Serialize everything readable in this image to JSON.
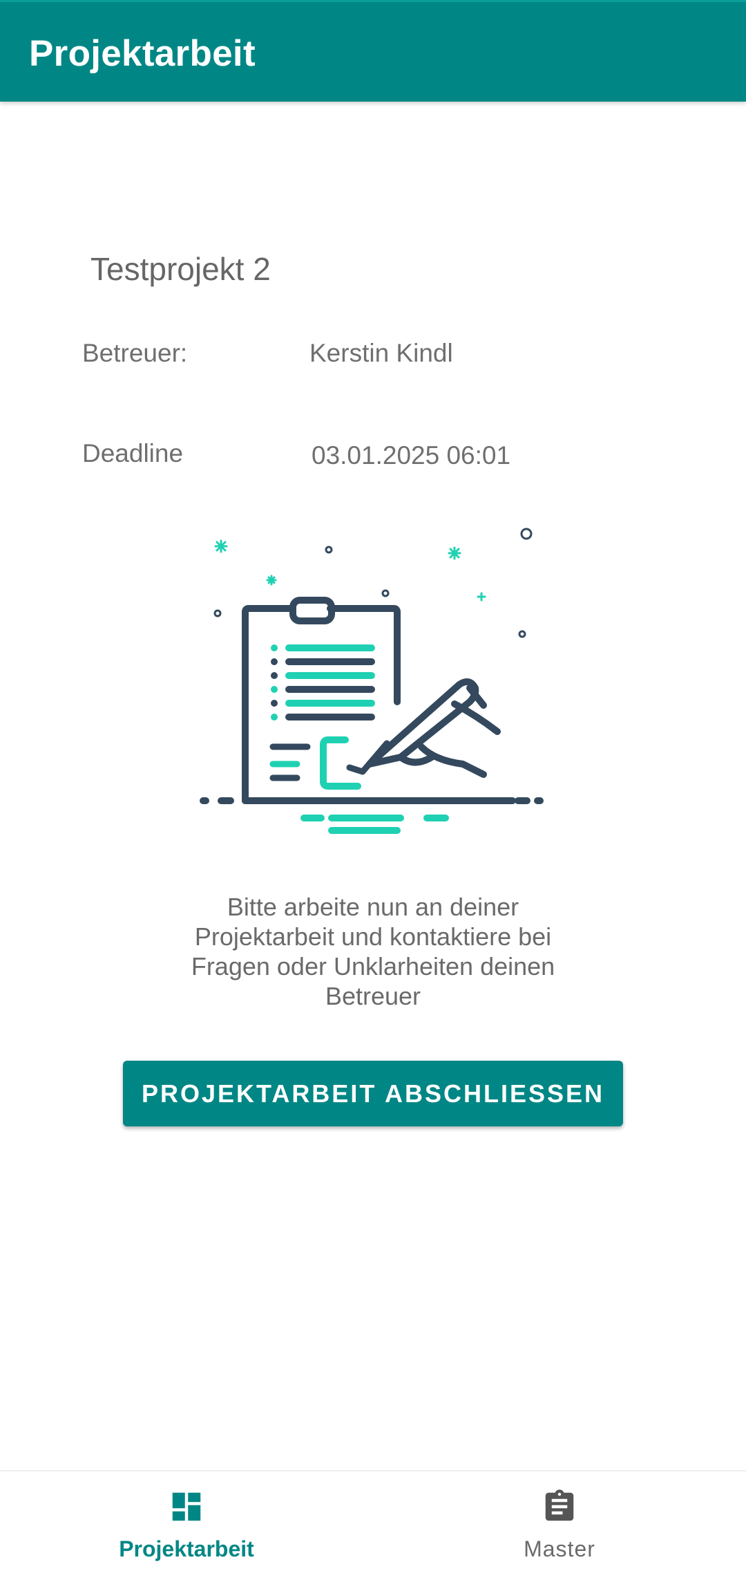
{
  "app_bar": {
    "title": "Projektarbeit"
  },
  "project": {
    "title": "Testprojekt 2",
    "supervisor_label": "Betreuer:",
    "supervisor_value": "Kerstin Kindl",
    "deadline_label": "Deadline",
    "deadline_value": "03.01.2025 06:01"
  },
  "illustration": {
    "icon": "clipboard-signing-illustration",
    "colors": {
      "dark": "#34495e",
      "accent": "#1fd1b2"
    }
  },
  "message": {
    "text": "Bitte arbeite nun an deiner Projektarbeit und kontaktiere bei Fragen oder Unklarheiten deinen Betreuer"
  },
  "actions": {
    "finish_label": "PROJEKTARBEIT ABSCHLIESSEN"
  },
  "bottom_nav": {
    "items": [
      {
        "label": "Projektarbeit",
        "icon": "dashboard-icon",
        "active": true
      },
      {
        "label": "Master",
        "icon": "clipboard-icon",
        "active": false
      }
    ]
  },
  "colors": {
    "primary": "#008785",
    "text_secondary": "#6f6f6f",
    "inactive_icon": "#555555"
  }
}
